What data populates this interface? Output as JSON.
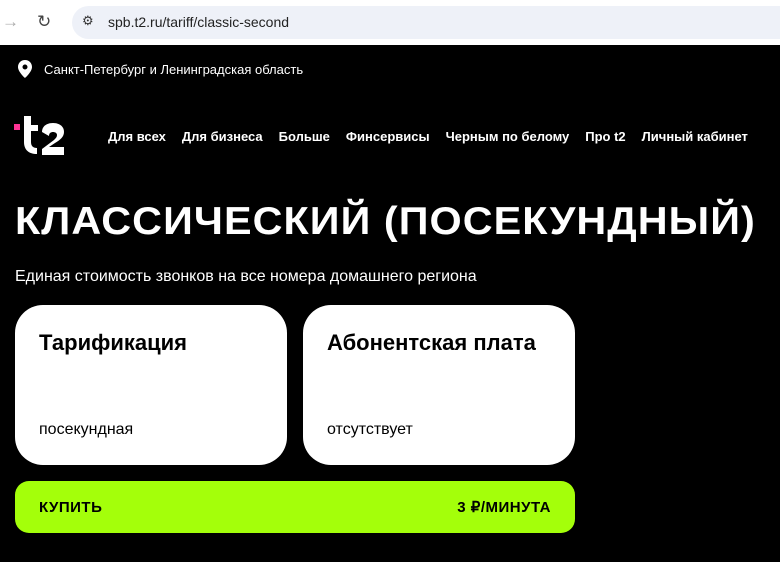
{
  "browser": {
    "url": "spb.t2.ru/tariff/classic-second"
  },
  "header": {
    "region": "Санкт-Петербург и Ленинградская область",
    "logo_text": "t2",
    "menu": [
      "Для всех",
      "Для бизнеса",
      "Больше",
      "Финсервисы",
      "Черным по белому",
      "Про t2",
      "Личный кабинет"
    ]
  },
  "main": {
    "title": "КЛАССИЧЕСКИЙ (ПОСЕКУНДНЫЙ)",
    "subtitle": "Единая стоимость звонков на все номера домашнего региона",
    "cards": [
      {
        "title": "Тарификация",
        "value": "посекундная"
      },
      {
        "title": "Абонентская плата",
        "value": "отсутствует"
      }
    ],
    "buy_label": "КУПИТЬ",
    "price": "3 ₽/МИНУТА"
  },
  "colors": {
    "accent": "#a4ff0a",
    "brand_pink": "#ff3495"
  }
}
